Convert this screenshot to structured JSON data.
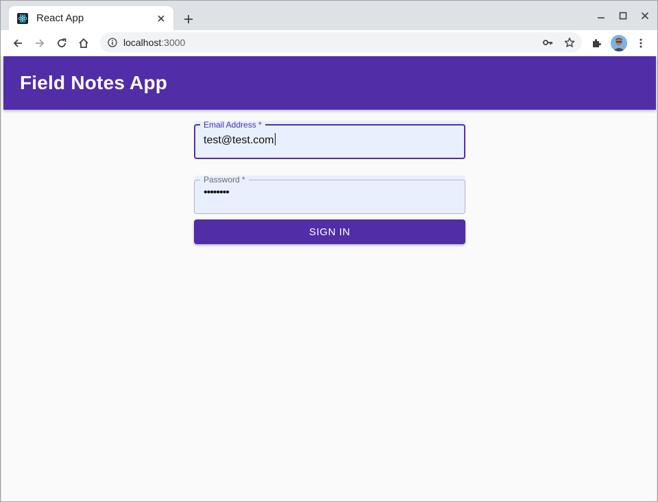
{
  "browser": {
    "tab": {
      "title": "React App",
      "favicon": "react-logo-icon"
    },
    "toolbar": {
      "url_host": "localhost",
      "url_port": ":3000"
    },
    "icons": [
      "back-icon",
      "forward-icon",
      "reload-icon",
      "home-icon",
      "info-icon",
      "key-icon",
      "star-icon",
      "extensions-icon",
      "menu-dots-icon",
      "minimize-icon",
      "maximize-icon",
      "close-icon",
      "new-tab-icon"
    ]
  },
  "app": {
    "title": "Field Notes App",
    "accent": "#512da8",
    "form": {
      "email": {
        "label": "Email Address *",
        "value": "test@test.com"
      },
      "password": {
        "label": "Password *",
        "value": "••••••••"
      },
      "submit_label": "SIGN IN"
    }
  }
}
